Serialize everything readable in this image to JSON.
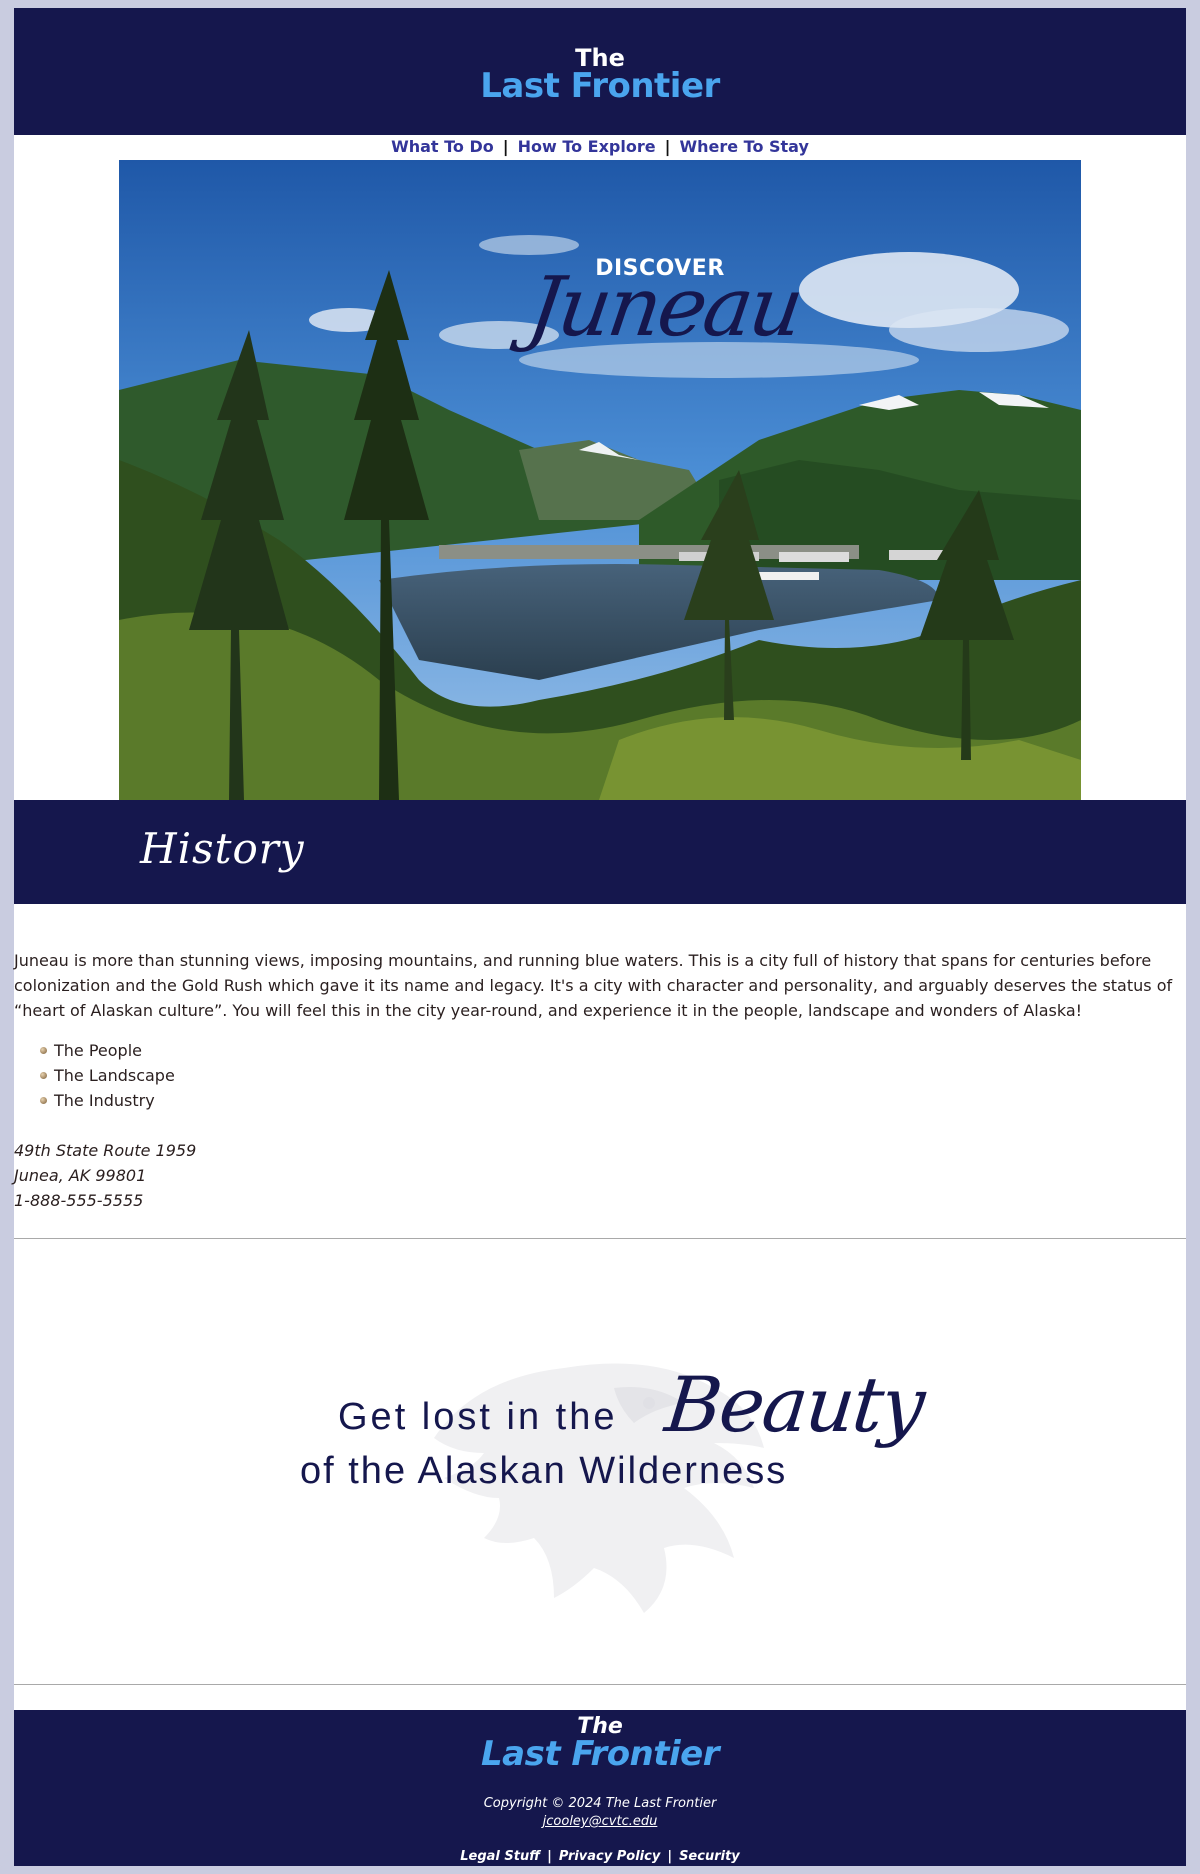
{
  "header": {
    "logo_the": "The",
    "logo_main": "Last Frontier"
  },
  "nav": {
    "items": [
      "What To Do",
      "How To Explore",
      "Where To Stay"
    ],
    "separator": "|"
  },
  "hero": {
    "kicker": "DISCOVER",
    "title": "Juneau"
  },
  "history": {
    "heading": "History",
    "intro": "Juneau is more than stunning views, imposing mountains, and running blue waters. This is a city full of history that spans for centuries before colonization and the Gold Rush which gave it its name and legacy. It's a city with character and personality, and arguably deserves the status of “heart of Alaskan culture”. You will feel this in the city year-round, and experience it in the people, landscape and wonders of Alaska!",
    "list": [
      "The People",
      "The Landscape",
      "The Industry"
    ],
    "address": [
      "49th State Route 1959",
      "Junea, AK 99801",
      "1-888-555-5555"
    ]
  },
  "tagline": {
    "line1": "Get lost in the",
    "accent": "Beauty",
    "line2": "of the Alaskan Wilderness"
  },
  "footer": {
    "logo_the": "The",
    "logo_main": "Last Frontier",
    "copyright": "Copyright © 2024 The Last Frontier",
    "email": "jcooley@cvtc.edu",
    "links": [
      "Legal Stuff",
      "Privacy Policy",
      "Security"
    ],
    "separator": "|"
  },
  "colors": {
    "navy": "#15174d",
    "sky_blue": "#4aa5ee",
    "nav_link": "#33359a",
    "page_bg": "#c9cce0"
  }
}
